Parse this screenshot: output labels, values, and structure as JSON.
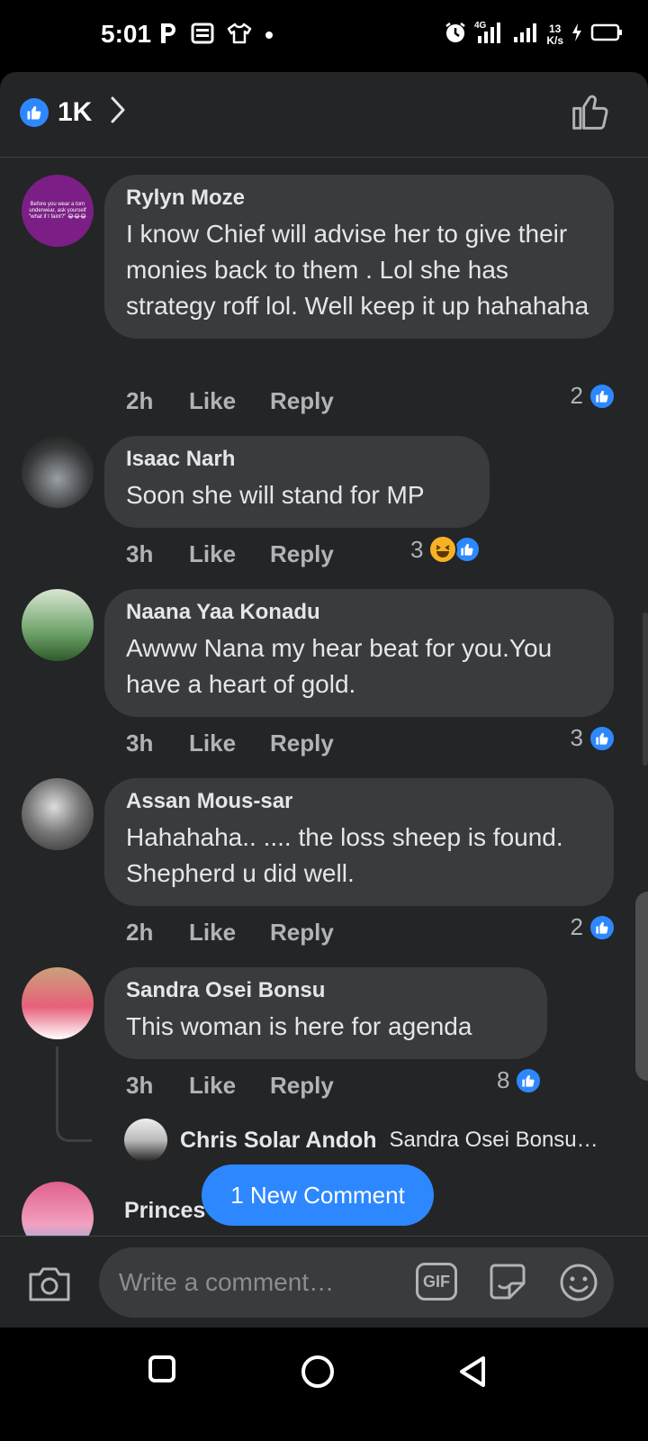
{
  "status_bar": {
    "time": "5:01",
    "net_speed_value": "13",
    "net_speed_unit": "K/s",
    "network_label": "4G"
  },
  "header": {
    "reaction_count": "1K"
  },
  "comments": [
    {
      "author": "Rylyn Moze",
      "text": "I know Chief will advise her to give their monies back to them . Lol she has strategy roff lol. Well  keep it up hahahaha",
      "time": "2h",
      "like_label": "Like",
      "reply_label": "Reply",
      "reactions": "2",
      "avatar_text": "Before you wear a torn underwear, ask yourself \"what if I faint?\" 😂😂😂"
    },
    {
      "author": "Isaac Narh",
      "text": "Soon she will stand for MP",
      "time": "3h",
      "like_label": "Like",
      "reply_label": "Reply",
      "reactions": "3"
    },
    {
      "author": "Naana Yaa Konadu",
      "text": "Awww Nana my hear beat for you.You have a heart of gold.",
      "time": "3h",
      "like_label": "Like",
      "reply_label": "Reply",
      "reactions": "3"
    },
    {
      "author": "Assan Mous-sar",
      "text": "Hahahaha.. .... the loss sheep is found. Shepherd u did well.",
      "time": "2h",
      "like_label": "Like",
      "reply_label": "Reply",
      "reactions": "2"
    },
    {
      "author": "Sandra Osei Bonsu",
      "text": "This woman is here for agenda",
      "time": "3h",
      "like_label": "Like",
      "reply_label": "Reply",
      "reactions": "8"
    }
  ],
  "reply_preview": {
    "author": "Chris Solar Andoh",
    "text": "Sandra Osei Bonsu…"
  },
  "partial_comment_author": "Princes",
  "new_comment_pill": "1 New Comment",
  "composer": {
    "placeholder": "Write a comment…",
    "gif_label": "GIF"
  },
  "colors": {
    "accent": "#2d88ff",
    "sheet_bg": "#242526",
    "bubble_bg": "#3a3b3c",
    "text_primary": "#e4e6eb",
    "text_secondary": "#b0b3b8"
  }
}
